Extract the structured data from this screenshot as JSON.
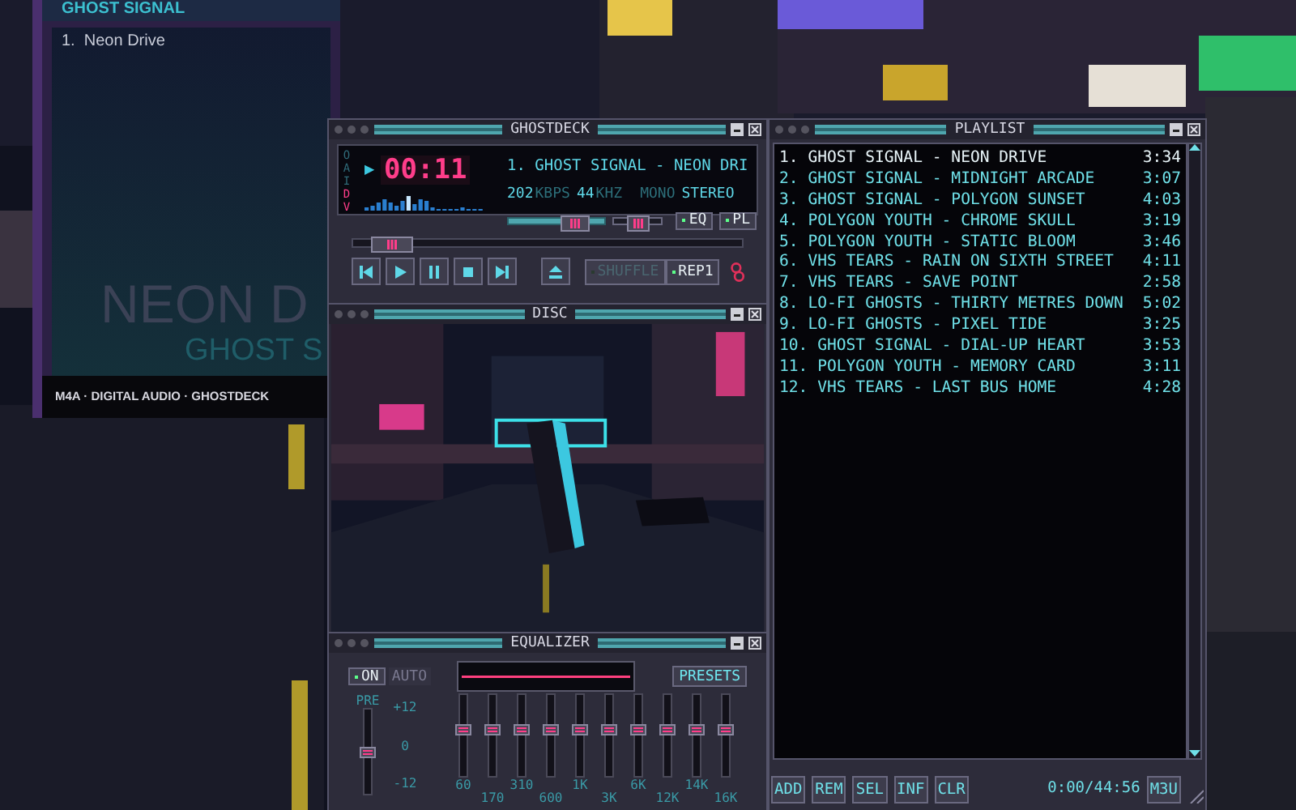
{
  "album_panel": {
    "header": "GHOST SIGNAL",
    "tracks": [
      "1.  Neon Drive"
    ],
    "title": "NEON D",
    "artist": "GHOST S",
    "footer": "M4A · DIGITAL AUDIO · GHOSTDECK"
  },
  "player": {
    "title": "GHOSTDECK",
    "clutterbar": [
      {
        "label": "O",
        "on": false
      },
      {
        "label": "A",
        "on": false
      },
      {
        "label": "I",
        "on": false
      },
      {
        "label": "D",
        "on": true
      },
      {
        "label": "V",
        "on": true
      }
    ],
    "play_indicator": "▶",
    "time": "00:11",
    "marquee": "1. GHOST SIGNAL - NEON DRI",
    "bitrate": "202",
    "bitrate_unit": "KBPS",
    "samplerate": "44",
    "samplerate_unit": "KHZ",
    "channels": [
      {
        "label": "MONO",
        "on": false
      },
      {
        "label": "STEREO",
        "on": true
      }
    ],
    "volume": {
      "level": 0.7
    },
    "balance": {
      "level": 0.5
    },
    "toggles": [
      {
        "label": "EQ",
        "on": true
      },
      {
        "label": "PL",
        "on": true
      }
    ],
    "seek": {
      "level": 0.1
    },
    "transport": [
      {
        "kind": "previous"
      },
      {
        "kind": "play"
      },
      {
        "kind": "pause"
      },
      {
        "kind": "stop"
      },
      {
        "kind": "next"
      },
      {
        "kind": "eject"
      }
    ],
    "modes": [
      {
        "label": "SHUFFLE",
        "on": false
      },
      {
        "label": "REP1",
        "on": true
      }
    ]
  },
  "disc": {
    "title": "DISC"
  },
  "equalizer": {
    "title": "EQUALIZER",
    "on_button": {
      "label": "ON",
      "on": true
    },
    "auto_button": {
      "label": "AUTO",
      "on": false
    },
    "presets": "PRESETS",
    "preamp": {
      "label": "PRE",
      "level": 0.5
    },
    "scale": [
      "+12",
      "0",
      "-12"
    ],
    "bands": [
      {
        "label": "60",
        "level": 0.58
      },
      {
        "label": "170",
        "level": 0.58
      },
      {
        "label": "310",
        "level": 0.58
      },
      {
        "label": "600",
        "level": 0.58
      },
      {
        "label": "1K",
        "level": 0.58
      },
      {
        "label": "3K",
        "level": 0.58
      },
      {
        "label": "6K",
        "level": 0.58
      },
      {
        "label": "12K",
        "level": 0.58
      },
      {
        "label": "14K",
        "level": 0.58
      },
      {
        "label": "16K",
        "level": 0.58
      }
    ]
  },
  "playlist": {
    "title": "PLAYLIST",
    "tracks": [
      {
        "title": "1. GHOST SIGNAL - NEON DRIVE",
        "duration": "3:34",
        "current": true
      },
      {
        "title": "2. GHOST SIGNAL - MIDNIGHT ARCADE",
        "duration": "3:07",
        "current": false
      },
      {
        "title": "3. GHOST SIGNAL - POLYGON SUNSET",
        "duration": "4:03",
        "current": false
      },
      {
        "title": "4. POLYGON YOUTH - CHROME SKULL",
        "duration": "3:19",
        "current": false
      },
      {
        "title": "5. POLYGON YOUTH - STATIC BLOOM",
        "duration": "3:46",
        "current": false
      },
      {
        "title": "6. VHS TEARS - RAIN ON SIXTH STREET",
        "duration": "4:11",
        "current": false
      },
      {
        "title": "7. VHS TEARS - SAVE POINT",
        "duration": "2:58",
        "current": false
      },
      {
        "title": "8. LO-FI GHOSTS - THIRTY METRES DOWN",
        "duration": "5:02",
        "current": false
      },
      {
        "title": "9. LO-FI GHOSTS - PIXEL TIDE",
        "duration": "3:25",
        "current": false
      },
      {
        "title": "10. GHOST SIGNAL - DIAL-UP HEART",
        "duration": "3:53",
        "current": false
      },
      {
        "title": "11. POLYGON YOUTH - MEMORY CARD",
        "duration": "3:11",
        "current": false
      },
      {
        "title": "12. VHS TEARS - LAST BUS HOME",
        "duration": "4:28",
        "current": false
      }
    ],
    "buttons": [
      "ADD",
      "REM",
      "SEL",
      "INF",
      "CLR"
    ],
    "total_time": "0:00/44:56",
    "format": "M3U"
  }
}
